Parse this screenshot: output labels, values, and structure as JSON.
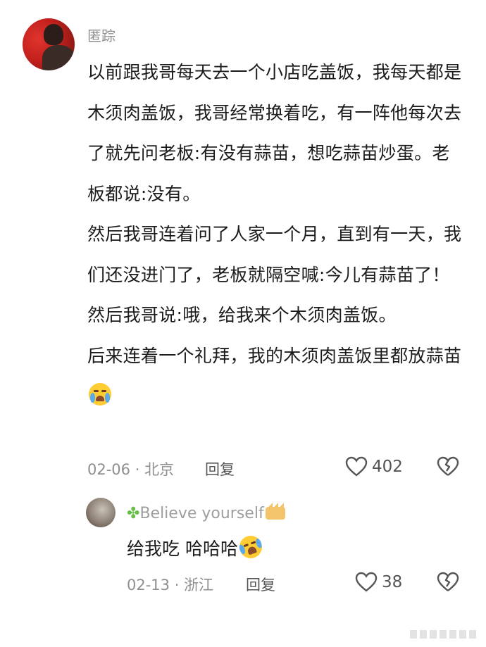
{
  "comment": {
    "username": "匿踪",
    "paragraphs": [
      "以前跟我哥每天去一个小店吃盖饭，我每天都是木须肉盖饭，我哥经常换着吃，有一阵他每次去了就先问老板:有没有蒜苗，想吃蒜苗炒蛋。老板都说:没有。",
      "然后我哥连着问了人家一个月，直到有一天，我们还没进门了，老板就隔空喊:今儿有蒜苗了！",
      "然后我哥说:哦，给我来个木须肉盖饭。",
      "后来连着一个礼拜，我的木须肉盖饭里都放蒜苗"
    ],
    "date_location": "02-06 · 北京",
    "reply_label": "回复",
    "likes": "402"
  },
  "reply": {
    "username": "Believe yourself",
    "text": "给我吃 哈哈哈",
    "date_location": "02-13 · 浙江",
    "reply_label": "回复",
    "likes": "38"
  }
}
